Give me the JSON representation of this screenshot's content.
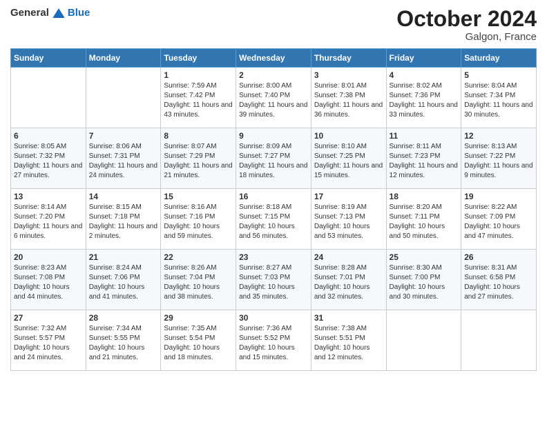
{
  "logo": {
    "general": "General",
    "blue": "Blue"
  },
  "header": {
    "month": "October 2024",
    "location": "Galgon, France"
  },
  "weekdays": [
    "Sunday",
    "Monday",
    "Tuesday",
    "Wednesday",
    "Thursday",
    "Friday",
    "Saturday"
  ],
  "weeks": [
    [
      {
        "day": "",
        "sunrise": "",
        "sunset": "",
        "daylight": "",
        "empty": true
      },
      {
        "day": "",
        "sunrise": "",
        "sunset": "",
        "daylight": "",
        "empty": true
      },
      {
        "day": "1",
        "sunrise": "Sunrise: 7:59 AM",
        "sunset": "Sunset: 7:42 PM",
        "daylight": "Daylight: 11 hours and 43 minutes."
      },
      {
        "day": "2",
        "sunrise": "Sunrise: 8:00 AM",
        "sunset": "Sunset: 7:40 PM",
        "daylight": "Daylight: 11 hours and 39 minutes."
      },
      {
        "day": "3",
        "sunrise": "Sunrise: 8:01 AM",
        "sunset": "Sunset: 7:38 PM",
        "daylight": "Daylight: 11 hours and 36 minutes."
      },
      {
        "day": "4",
        "sunrise": "Sunrise: 8:02 AM",
        "sunset": "Sunset: 7:36 PM",
        "daylight": "Daylight: 11 hours and 33 minutes."
      },
      {
        "day": "5",
        "sunrise": "Sunrise: 8:04 AM",
        "sunset": "Sunset: 7:34 PM",
        "daylight": "Daylight: 11 hours and 30 minutes."
      }
    ],
    [
      {
        "day": "6",
        "sunrise": "Sunrise: 8:05 AM",
        "sunset": "Sunset: 7:32 PM",
        "daylight": "Daylight: 11 hours and 27 minutes."
      },
      {
        "day": "7",
        "sunrise": "Sunrise: 8:06 AM",
        "sunset": "Sunset: 7:31 PM",
        "daylight": "Daylight: 11 hours and 24 minutes."
      },
      {
        "day": "8",
        "sunrise": "Sunrise: 8:07 AM",
        "sunset": "Sunset: 7:29 PM",
        "daylight": "Daylight: 11 hours and 21 minutes."
      },
      {
        "day": "9",
        "sunrise": "Sunrise: 8:09 AM",
        "sunset": "Sunset: 7:27 PM",
        "daylight": "Daylight: 11 hours and 18 minutes."
      },
      {
        "day": "10",
        "sunrise": "Sunrise: 8:10 AM",
        "sunset": "Sunset: 7:25 PM",
        "daylight": "Daylight: 11 hours and 15 minutes."
      },
      {
        "day": "11",
        "sunrise": "Sunrise: 8:11 AM",
        "sunset": "Sunset: 7:23 PM",
        "daylight": "Daylight: 11 hours and 12 minutes."
      },
      {
        "day": "12",
        "sunrise": "Sunrise: 8:13 AM",
        "sunset": "Sunset: 7:22 PM",
        "daylight": "Daylight: 11 hours and 9 minutes."
      }
    ],
    [
      {
        "day": "13",
        "sunrise": "Sunrise: 8:14 AM",
        "sunset": "Sunset: 7:20 PM",
        "daylight": "Daylight: 11 hours and 6 minutes."
      },
      {
        "day": "14",
        "sunrise": "Sunrise: 8:15 AM",
        "sunset": "Sunset: 7:18 PM",
        "daylight": "Daylight: 11 hours and 2 minutes."
      },
      {
        "day": "15",
        "sunrise": "Sunrise: 8:16 AM",
        "sunset": "Sunset: 7:16 PM",
        "daylight": "Daylight: 10 hours and 59 minutes."
      },
      {
        "day": "16",
        "sunrise": "Sunrise: 8:18 AM",
        "sunset": "Sunset: 7:15 PM",
        "daylight": "Daylight: 10 hours and 56 minutes."
      },
      {
        "day": "17",
        "sunrise": "Sunrise: 8:19 AM",
        "sunset": "Sunset: 7:13 PM",
        "daylight": "Daylight: 10 hours and 53 minutes."
      },
      {
        "day": "18",
        "sunrise": "Sunrise: 8:20 AM",
        "sunset": "Sunset: 7:11 PM",
        "daylight": "Daylight: 10 hours and 50 minutes."
      },
      {
        "day": "19",
        "sunrise": "Sunrise: 8:22 AM",
        "sunset": "Sunset: 7:09 PM",
        "daylight": "Daylight: 10 hours and 47 minutes."
      }
    ],
    [
      {
        "day": "20",
        "sunrise": "Sunrise: 8:23 AM",
        "sunset": "Sunset: 7:08 PM",
        "daylight": "Daylight: 10 hours and 44 minutes."
      },
      {
        "day": "21",
        "sunrise": "Sunrise: 8:24 AM",
        "sunset": "Sunset: 7:06 PM",
        "daylight": "Daylight: 10 hours and 41 minutes."
      },
      {
        "day": "22",
        "sunrise": "Sunrise: 8:26 AM",
        "sunset": "Sunset: 7:04 PM",
        "daylight": "Daylight: 10 hours and 38 minutes."
      },
      {
        "day": "23",
        "sunrise": "Sunrise: 8:27 AM",
        "sunset": "Sunset: 7:03 PM",
        "daylight": "Daylight: 10 hours and 35 minutes."
      },
      {
        "day": "24",
        "sunrise": "Sunrise: 8:28 AM",
        "sunset": "Sunset: 7:01 PM",
        "daylight": "Daylight: 10 hours and 32 minutes."
      },
      {
        "day": "25",
        "sunrise": "Sunrise: 8:30 AM",
        "sunset": "Sunset: 7:00 PM",
        "daylight": "Daylight: 10 hours and 30 minutes."
      },
      {
        "day": "26",
        "sunrise": "Sunrise: 8:31 AM",
        "sunset": "Sunset: 6:58 PM",
        "daylight": "Daylight: 10 hours and 27 minutes."
      }
    ],
    [
      {
        "day": "27",
        "sunrise": "Sunrise: 7:32 AM",
        "sunset": "Sunset: 5:57 PM",
        "daylight": "Daylight: 10 hours and 24 minutes."
      },
      {
        "day": "28",
        "sunrise": "Sunrise: 7:34 AM",
        "sunset": "Sunset: 5:55 PM",
        "daylight": "Daylight: 10 hours and 21 minutes."
      },
      {
        "day": "29",
        "sunrise": "Sunrise: 7:35 AM",
        "sunset": "Sunset: 5:54 PM",
        "daylight": "Daylight: 10 hours and 18 minutes."
      },
      {
        "day": "30",
        "sunrise": "Sunrise: 7:36 AM",
        "sunset": "Sunset: 5:52 PM",
        "daylight": "Daylight: 10 hours and 15 minutes."
      },
      {
        "day": "31",
        "sunrise": "Sunrise: 7:38 AM",
        "sunset": "Sunset: 5:51 PM",
        "daylight": "Daylight: 10 hours and 12 minutes."
      },
      {
        "day": "",
        "sunrise": "",
        "sunset": "",
        "daylight": "",
        "empty": true
      },
      {
        "day": "",
        "sunrise": "",
        "sunset": "",
        "daylight": "",
        "empty": true
      }
    ]
  ]
}
